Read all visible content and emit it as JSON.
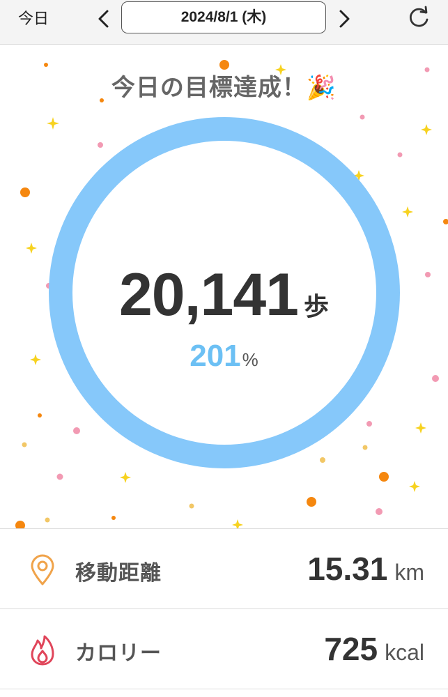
{
  "header": {
    "today_label": "今日",
    "date": "2024/8/1 (木)"
  },
  "main": {
    "goal_message": "今日の目標達成！🎉",
    "steps": "20,141",
    "steps_unit": "歩",
    "progress_percent": "201",
    "progress_unit": "%",
    "ring_color": "#86c8fa"
  },
  "stats": [
    {
      "label": "移動距離",
      "value": "15.31",
      "unit": "km",
      "icon": "location-pin-icon",
      "color": "#f0a34a"
    },
    {
      "label": "カロリー",
      "value": "725",
      "unit": "kcal",
      "icon": "flame-icon",
      "color": "#e0455a"
    }
  ]
}
